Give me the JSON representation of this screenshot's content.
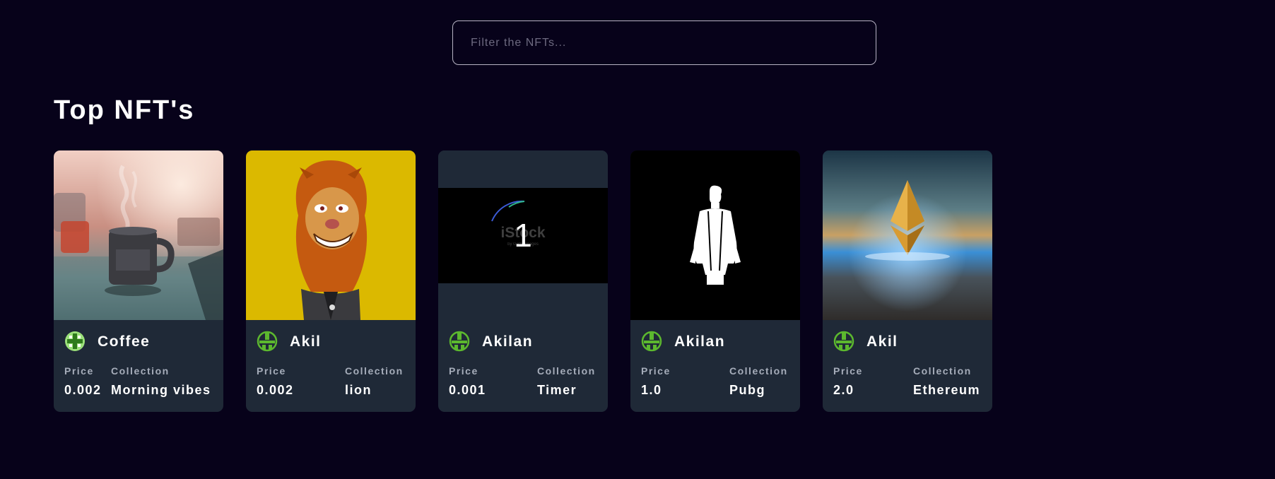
{
  "search": {
    "placeholder": "Filter the NFTs..."
  },
  "section_title": "Top NFT's",
  "labels": {
    "price": "Price",
    "collection": "Collection"
  },
  "cards": [
    {
      "name": "Coffee",
      "price": "0.002",
      "collection": "Morning vibes",
      "image": "coffee-mug-photo",
      "avatar": "green-pixel-cross-avatar-icon"
    },
    {
      "name": "Akil",
      "price": "0.002",
      "collection": "lion",
      "image": "cartoon-lion-illustration",
      "avatar": "green-pixel-avatar-icon"
    },
    {
      "name": "Akilan",
      "price": "0.001",
      "collection": "Timer",
      "image": "istock-countdown-timer-video-frame",
      "avatar": "green-pixel-avatar-icon"
    },
    {
      "name": "Akilan",
      "price": "1.0",
      "collection": "Pubg",
      "image": "pubg-character-silhouette",
      "avatar": "green-pixel-avatar-icon"
    },
    {
      "name": "Akil",
      "price": "2.0",
      "collection": "Ethereum",
      "image": "ethereum-logo-over-water",
      "avatar": "green-pixel-avatar-icon"
    }
  ],
  "media_text": {
    "watermark": "iStock",
    "watermark_sub": "by Getty Images",
    "timer_digit": "1"
  },
  "colors": {
    "background": "#07021a",
    "card": "#1f2937",
    "label": "#a6adba",
    "input_border": "#b7b3c4",
    "avatar_green": "#5cb82e"
  }
}
